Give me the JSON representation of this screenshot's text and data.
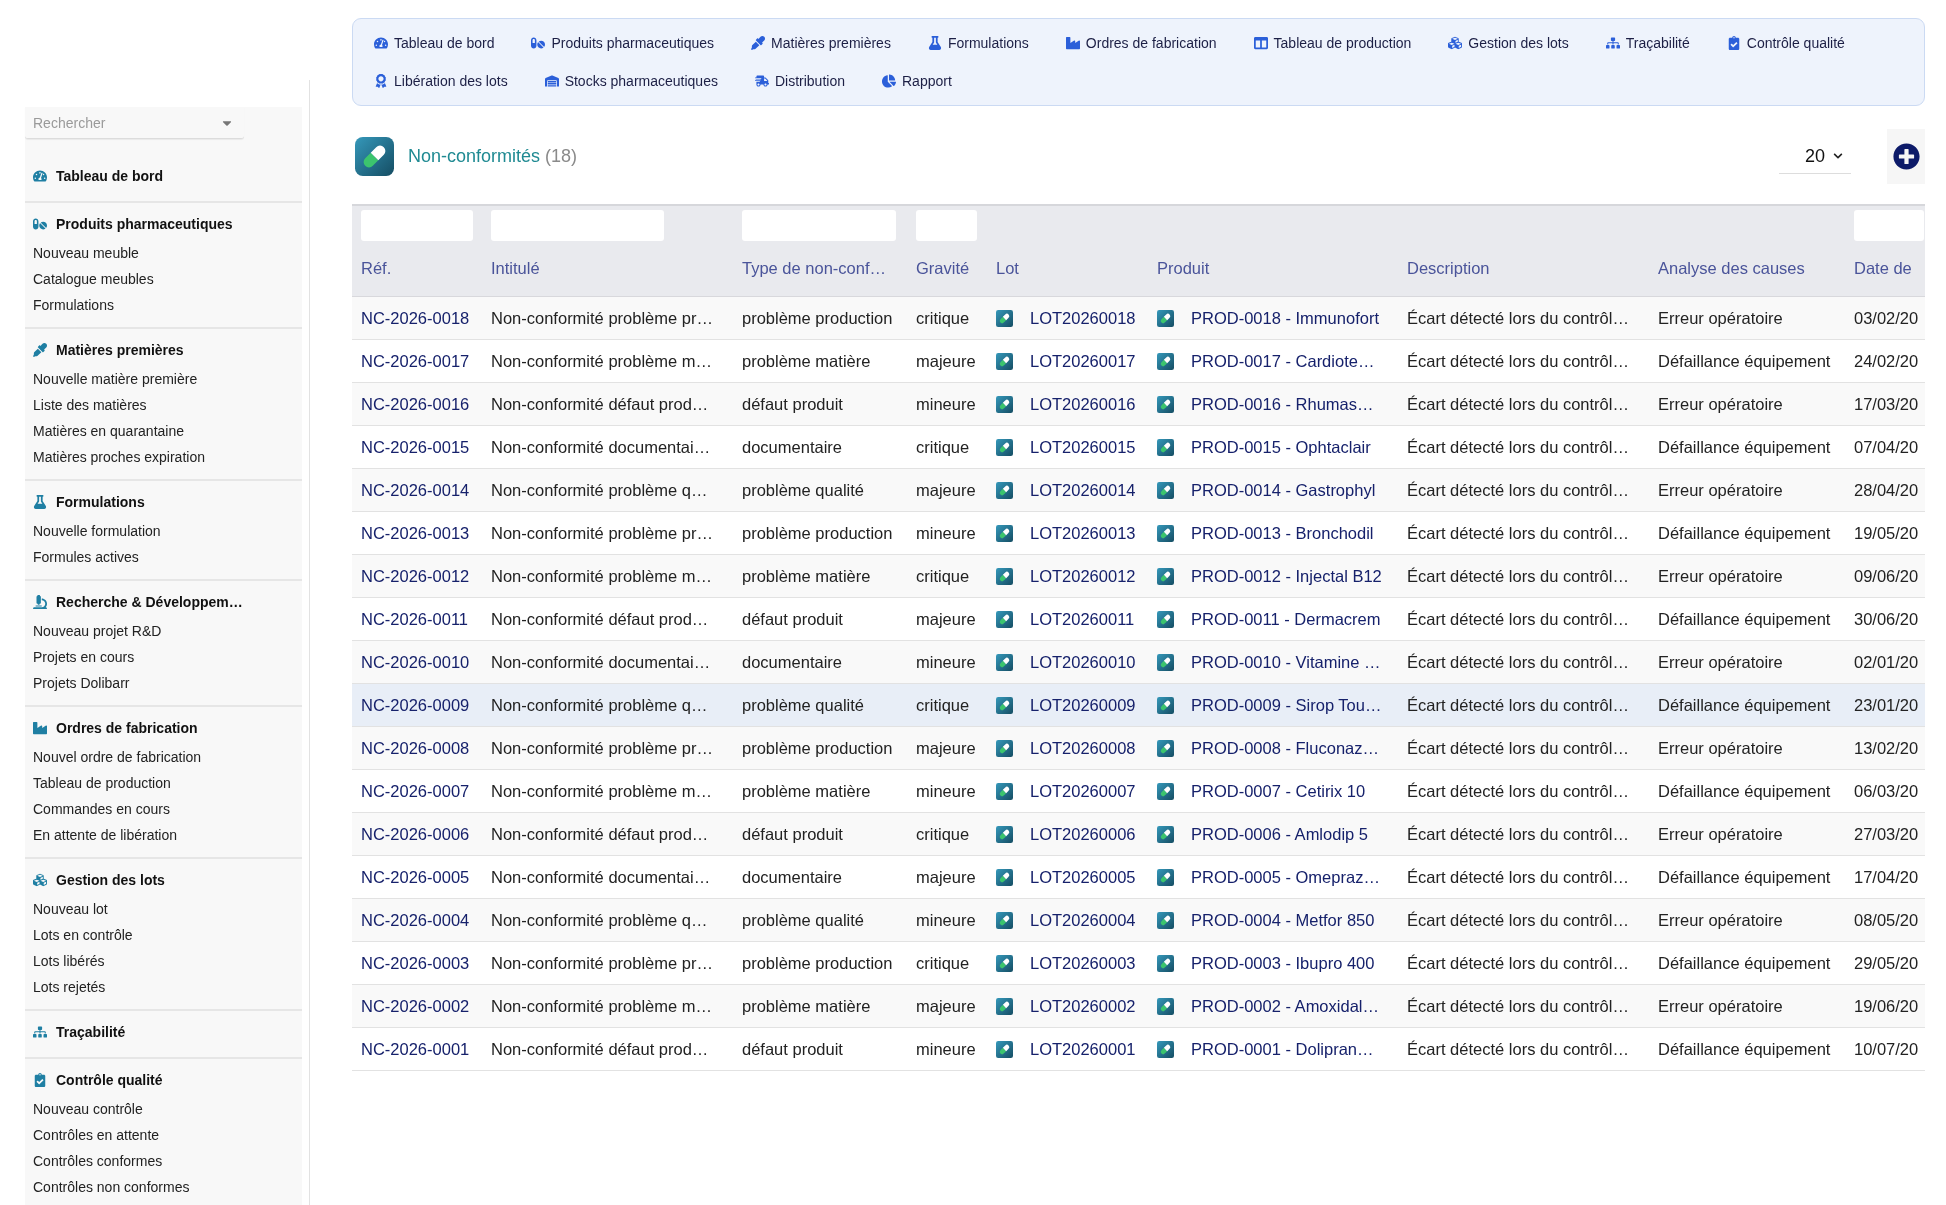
{
  "sidebar": {
    "search": {
      "placeholder": "Rechercher"
    },
    "sections": [
      {
        "title": "Tableau de bord"
      },
      {
        "title": "Produits pharmaceutiques",
        "items": [
          "Nouveau meuble",
          "Catalogue meubles",
          "Formulations"
        ]
      },
      {
        "title": "Matières premières",
        "items": [
          "Nouvelle matière première",
          "Liste des matières",
          "Matières en quarantaine",
          "Matières proches expiration"
        ]
      },
      {
        "title": "Formulations",
        "items": [
          "Nouvelle formulation",
          "Formules actives"
        ]
      },
      {
        "title": "Recherche & Développem…",
        "items": [
          "Nouveau projet R&D",
          "Projets en cours",
          "Projets Dolibarr"
        ]
      },
      {
        "title": "Ordres de fabrication",
        "items": [
          "Nouvel ordre de fabrication",
          "Tableau de production",
          "Commandes en cours",
          "En attente de libération"
        ]
      },
      {
        "title": "Gestion des lots",
        "items": [
          "Nouveau lot",
          "Lots en contrôle",
          "Lots libérés",
          "Lots rejetés"
        ]
      },
      {
        "title": "Traçabilité"
      },
      {
        "title": "Contrôle qualité",
        "items": [
          "Nouveau contrôle",
          "Contrôles en attente",
          "Contrôles conformes",
          "Contrôles non conformes"
        ]
      }
    ]
  },
  "top_menu": [
    "Tableau de bord",
    "Produits pharmaceutiques",
    "Matières premières",
    "Formulations",
    "Ordres de fabrication",
    "Tableau de production",
    "Gestion des lots",
    "Traçabilité",
    "Contrôle qualité",
    "Libération des lots",
    "Stocks pharmaceutiques",
    "Distribution",
    "Rapport"
  ],
  "page": {
    "title": "Non-conformités",
    "count": "(18)",
    "per_page": "20"
  },
  "table": {
    "columns": [
      {
        "label": "Réf.",
        "kind": "link",
        "filter": true
      },
      {
        "label": "Intitulé",
        "kind": "text",
        "filter": true
      },
      {
        "label": "Type de non-conf…",
        "kind": "text",
        "filter": true
      },
      {
        "label": "Gravité",
        "kind": "text",
        "filter": true
      },
      {
        "label": "Lot",
        "kind": "icon_link",
        "filter": false
      },
      {
        "label": "Produit",
        "kind": "icon_link",
        "filter": false
      },
      {
        "label": "Description",
        "kind": "text",
        "filter": false
      },
      {
        "label": "Analyse des causes",
        "kind": "text",
        "filter": false
      },
      {
        "label": "Date de",
        "kind": "text",
        "filter": true
      }
    ],
    "rows": [
      {
        "selected": false,
        "cells": [
          "NC-2026-0018",
          "Non-conformité problème pr…",
          "problème production",
          "critique",
          "LOT20260018",
          "PROD-0018 - Immunofort",
          "Écart détecté lors du contrôl…",
          "Erreur opératoire",
          "03/02/20"
        ]
      },
      {
        "selected": false,
        "cells": [
          "NC-2026-0017",
          "Non-conformité problème m…",
          "problème matière",
          "majeure",
          "LOT20260017",
          "PROD-0017 - Cardiote…",
          "Écart détecté lors du contrôl…",
          "Défaillance équipement",
          "24/02/20"
        ]
      },
      {
        "selected": false,
        "cells": [
          "NC-2026-0016",
          "Non-conformité défaut prod…",
          "défaut produit",
          "mineure",
          "LOT20260016",
          "PROD-0016 - Rhumas…",
          "Écart détecté lors du contrôl…",
          "Erreur opératoire",
          "17/03/20"
        ]
      },
      {
        "selected": false,
        "cells": [
          "NC-2026-0015",
          "Non-conformité documentai…",
          "documentaire",
          "critique",
          "LOT20260015",
          "PROD-0015 - Ophtaclair",
          "Écart détecté lors du contrôl…",
          "Défaillance équipement",
          "07/04/20"
        ]
      },
      {
        "selected": false,
        "cells": [
          "NC-2026-0014",
          "Non-conformité problème q…",
          "problème qualité",
          "majeure",
          "LOT20260014",
          "PROD-0014 - Gastrophyl",
          "Écart détecté lors du contrôl…",
          "Erreur opératoire",
          "28/04/20"
        ]
      },
      {
        "selected": false,
        "cells": [
          "NC-2026-0013",
          "Non-conformité problème pr…",
          "problème production",
          "mineure",
          "LOT20260013",
          "PROD-0013 - Bronchodil",
          "Écart détecté lors du contrôl…",
          "Défaillance équipement",
          "19/05/20"
        ]
      },
      {
        "selected": false,
        "cells": [
          "NC-2026-0012",
          "Non-conformité problème m…",
          "problème matière",
          "critique",
          "LOT20260012",
          "PROD-0012 - Injectal B12",
          "Écart détecté lors du contrôl…",
          "Erreur opératoire",
          "09/06/20"
        ]
      },
      {
        "selected": false,
        "cells": [
          "NC-2026-0011",
          "Non-conformité défaut prod…",
          "défaut produit",
          "majeure",
          "LOT20260011",
          "PROD-0011 - Dermacrem",
          "Écart détecté lors du contrôl…",
          "Défaillance équipement",
          "30/06/20"
        ]
      },
      {
        "selected": false,
        "cells": [
          "NC-2026-0010",
          "Non-conformité documentai…",
          "documentaire",
          "mineure",
          "LOT20260010",
          "PROD-0010 - Vitamine …",
          "Écart détecté lors du contrôl…",
          "Erreur opératoire",
          "02/01/20"
        ]
      },
      {
        "selected": true,
        "cells": [
          "NC-2026-0009",
          "Non-conformité problème q…",
          "problème qualité",
          "critique",
          "LOT20260009",
          "PROD-0009 - Sirop Tou…",
          "Écart détecté lors du contrôl…",
          "Défaillance équipement",
          "23/01/20"
        ]
      },
      {
        "selected": false,
        "cells": [
          "NC-2026-0008",
          "Non-conformité problème pr…",
          "problème production",
          "majeure",
          "LOT20260008",
          "PROD-0008 - Fluconaz…",
          "Écart détecté lors du contrôl…",
          "Erreur opératoire",
          "13/02/20"
        ]
      },
      {
        "selected": false,
        "cells": [
          "NC-2026-0007",
          "Non-conformité problème m…",
          "problème matière",
          "mineure",
          "LOT20260007",
          "PROD-0007 - Cetirix 10",
          "Écart détecté lors du contrôl…",
          "Défaillance équipement",
          "06/03/20"
        ]
      },
      {
        "selected": false,
        "cells": [
          "NC-2026-0006",
          "Non-conformité défaut prod…",
          "défaut produit",
          "critique",
          "LOT20260006",
          "PROD-0006 - Amlodip 5",
          "Écart détecté lors du contrôl…",
          "Erreur opératoire",
          "27/03/20"
        ]
      },
      {
        "selected": false,
        "cells": [
          "NC-2026-0005",
          "Non-conformité documentai…",
          "documentaire",
          "majeure",
          "LOT20260005",
          "PROD-0005 - Omepraz…",
          "Écart détecté lors du contrôl…",
          "Défaillance équipement",
          "17/04/20"
        ]
      },
      {
        "selected": false,
        "cells": [
          "NC-2026-0004",
          "Non-conformité problème q…",
          "problème qualité",
          "mineure",
          "LOT20260004",
          "PROD-0004 - Metfor 850",
          "Écart détecté lors du contrôl…",
          "Erreur opératoire",
          "08/05/20"
        ]
      },
      {
        "selected": false,
        "cells": [
          "NC-2026-0003",
          "Non-conformité problème pr…",
          "problème production",
          "critique",
          "LOT20260003",
          "PROD-0003 - Ibupro 400",
          "Écart détecté lors du contrôl…",
          "Défaillance équipement",
          "29/05/20"
        ]
      },
      {
        "selected": false,
        "cells": [
          "NC-2026-0002",
          "Non-conformité problème m…",
          "problème matière",
          "majeure",
          "LOT20260002",
          "PROD-0002 - Amoxidal…",
          "Écart détecté lors du contrôl…",
          "Erreur opératoire",
          "19/06/20"
        ]
      },
      {
        "selected": false,
        "cells": [
          "NC-2026-0001",
          "Non-conformité défaut prod…",
          "défaut produit",
          "mineure",
          "LOT20260001",
          "PROD-0001 - Dolipran…",
          "Écart détecté lors du contrôl…",
          "Défaillance équipement",
          "10/07/20"
        ]
      }
    ]
  }
}
